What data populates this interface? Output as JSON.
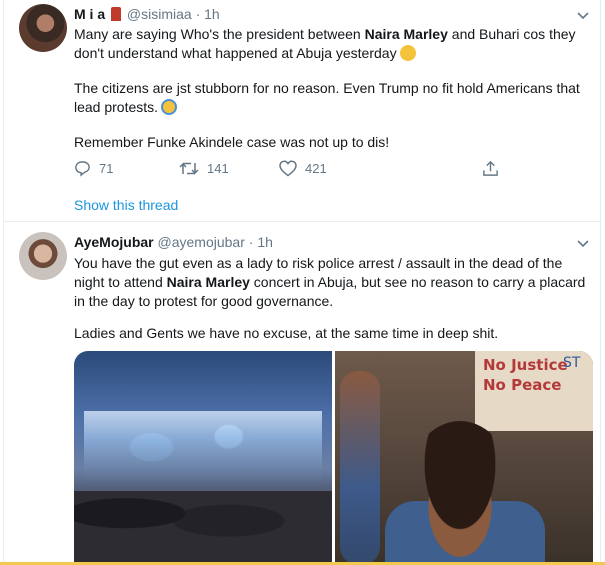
{
  "tweets": [
    {
      "display_name": "M i a",
      "handle": "@sisimiaa",
      "separator": "·",
      "time": "1h",
      "paragraph1_before": "Many are saying Who's the president between ",
      "paragraph1_bold": "Naira Marley",
      "paragraph1_after": " and Buhari cos they don't understand what happened at Abuja yesterday",
      "paragraph2": "The citizens are jst stubborn for no reason. Even Trump no fit hold Americans that lead protests.",
      "paragraph3": "Remember Funke Akindele case was not up to dis!",
      "replies": "71",
      "retweets": "141",
      "likes": "421",
      "show_thread": "Show this thread"
    },
    {
      "display_name": "AyeMojubar",
      "handle": "@ayemojubar",
      "separator": "·",
      "time": "1h",
      "paragraph1_before": "You have the gut even as a lady to risk police arrest / assault in the dead of the night to attend ",
      "paragraph1_bold": "Naira Marley",
      "paragraph1_after": " concert in Abuja, but see no reason to carry a placard in the day to protest for good governance.",
      "paragraph2": "Ladies and Gents we have no excuse, at the same time in deep shit.",
      "placard_line1": "No Justice",
      "placard_line2": "No Peace",
      "placard_number": "ST"
    }
  ],
  "colors": {
    "link": "#1b95e0",
    "muted": "#657786",
    "text": "#14171a",
    "border": "#e6ecf0"
  },
  "icons": [
    "chevron-down-icon",
    "reply-icon",
    "retweet-icon",
    "like-icon",
    "share-icon"
  ]
}
